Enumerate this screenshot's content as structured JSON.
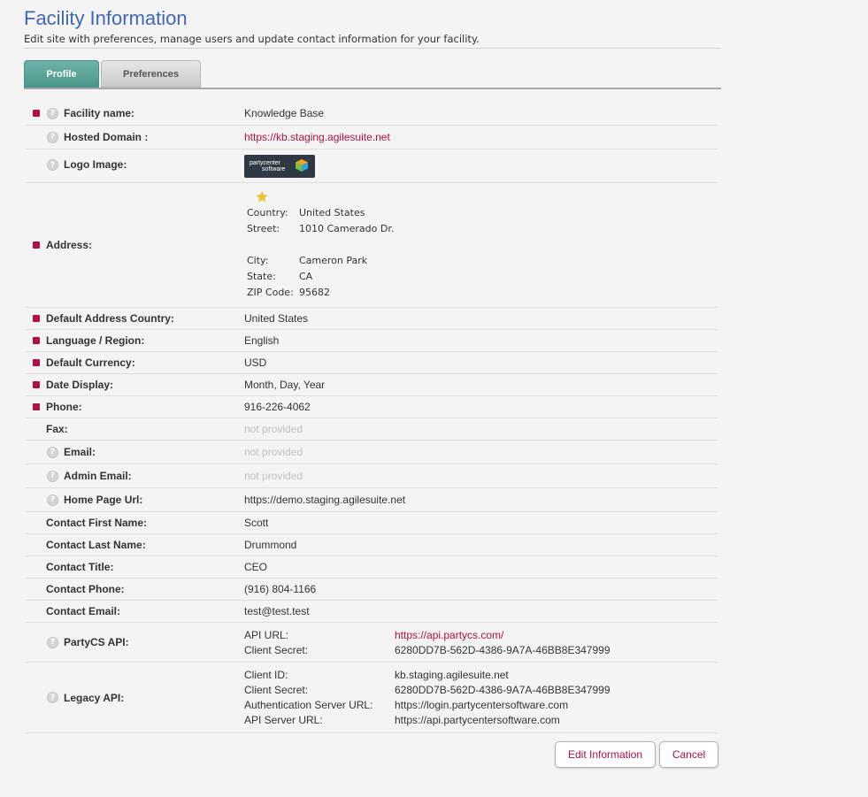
{
  "page": {
    "title": "Facility Information",
    "subtitle": "Edit site with preferences, manage users and update contact information for your facility."
  },
  "tabs": [
    {
      "label": "Profile",
      "active": true
    },
    {
      "label": "Preferences",
      "active": false
    }
  ],
  "fields": {
    "facility_name": {
      "label": "Facility name:",
      "value": "Knowledge Base",
      "required": true,
      "help": true
    },
    "hosted_domain": {
      "label": "Hosted Domain :",
      "value": "https://kb.staging.agilesuite.net",
      "help": true
    },
    "logo_image": {
      "label": "Logo Image:",
      "logo_text_1": "partycenter",
      "logo_text_2": "software",
      "help": true
    },
    "address": {
      "label": "Address:",
      "required": true,
      "lines": [
        {
          "key": "Country:",
          "value": "United States"
        },
        {
          "key": "Street:",
          "value": "1010 Camerado Dr."
        },
        {
          "key": "",
          "value": ""
        },
        {
          "key": "City:",
          "value": "Cameron Park"
        },
        {
          "key": "State:",
          "value": "CA"
        },
        {
          "key": "ZIP Code:",
          "value": "95682"
        }
      ]
    },
    "default_address_country": {
      "label": "Default Address Country:",
      "value": "United States",
      "required": true
    },
    "language_region": {
      "label": "Language / Region:",
      "value": "English",
      "required": true
    },
    "default_currency": {
      "label": "Default Currency:",
      "value": "USD",
      "required": true
    },
    "date_display": {
      "label": "Date Display:",
      "value": "Month, Day, Year",
      "required": true
    },
    "phone": {
      "label": "Phone:",
      "value": "916-226-4062",
      "required": true
    },
    "fax": {
      "label": "Fax:",
      "value": "not provided"
    },
    "email": {
      "label": "Email:",
      "value": "not provided",
      "help": true
    },
    "admin_email": {
      "label": "Admin Email:",
      "value": "not provided",
      "help": true
    },
    "home_page_url": {
      "label": "Home Page Url:",
      "value": "https://demo.staging.agilesuite.net",
      "help": true
    },
    "contact_first_name": {
      "label": "Contact First Name:",
      "value": "Scott"
    },
    "contact_last_name": {
      "label": "Contact Last Name:",
      "value": "Drummond"
    },
    "contact_title": {
      "label": "Contact Title:",
      "value": "CEO"
    },
    "contact_phone": {
      "label": "Contact Phone:",
      "value": "(916) 804-1166"
    },
    "contact_email": {
      "label": "Contact Email:",
      "value": "test@test.test"
    },
    "partycs_api": {
      "label": "PartyCS API:",
      "help": true,
      "api_url_key": "API URL:",
      "api_url_value": "https://api.partycs.com/",
      "client_secret_key": "Client Secret:",
      "client_secret_value": "6280DD7B-562D-4386-9A7A-46BB8E347999"
    },
    "legacy_api": {
      "label": "Legacy API:",
      "help": true,
      "client_id_key": "Client ID:",
      "client_id_value": "kb.staging.agilesuite.net",
      "client_secret_key": "Client Secret:",
      "client_secret_value": "6280DD7B-562D-4386-9A7A-46BB8E347999",
      "auth_url_key": "Authentication Server URL:",
      "auth_url_value": "https://login.partycentersoftware.com",
      "api_server_key": "API Server URL:",
      "api_server_value": "https://api.partycentersoftware.com"
    }
  },
  "buttons": {
    "edit": "Edit Information",
    "cancel": "Cancel"
  },
  "icons": {
    "help": "help-icon",
    "required": "required-marker",
    "star": "star-icon"
  },
  "colors": {
    "title": "#4066b8",
    "accent": "#b01043",
    "active_tab": "#5aa69b"
  }
}
